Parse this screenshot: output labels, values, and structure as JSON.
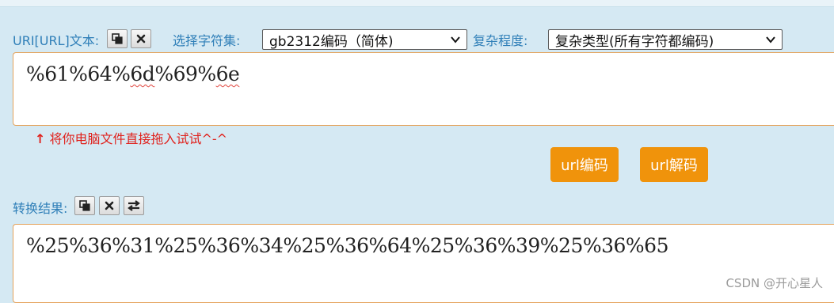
{
  "encoder": {
    "uri_label": "URI[URL]文本:",
    "charset_label": "选择字符集:",
    "charset_value": "gb2312编码（简体)",
    "complexity_label": "复杂程度:",
    "complexity_value": "复杂类型(所有字符都编码)",
    "input_text_pre": "%61%64%",
    "input_text_squig1": "6d",
    "input_text_mid": "%69%",
    "input_text_squig2": "6e",
    "hint_arrow": "↑",
    "hint_text": "将你电脑文件直接拖入试试^-^",
    "encode_button": "url编码",
    "decode_button": "url解码",
    "result_label": "转换结果:",
    "result_text": "%25%36%31%25%36%34%25%36%64%25%36%39%25%36%65"
  },
  "watermark": "CSDN @开心星人",
  "colors": {
    "label": "#2f7fb8",
    "accent": "#f0930b",
    "hint": "#e0201b",
    "background": "#d5e9f3"
  },
  "icons": [
    "copy-icon",
    "close-icon",
    "swap-icon",
    "chevron-down-icon"
  ]
}
